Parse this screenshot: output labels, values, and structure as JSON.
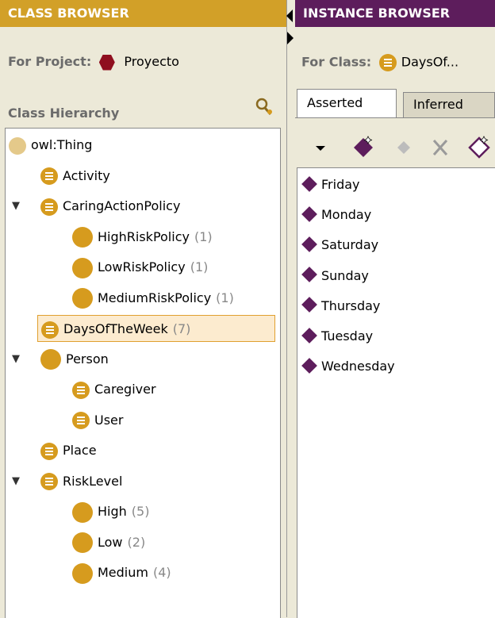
{
  "class_browser": {
    "header": "CLASS BROWSER",
    "for_label": "For Project:",
    "project_name": "Proyecto",
    "hierarchy_title": "Class Hierarchy",
    "tree": [
      {
        "label": "owl:Thing",
        "count": "",
        "depth": 0,
        "icon": "thing-icon",
        "expander": ""
      },
      {
        "label": "Activity",
        "count": "",
        "depth": 1,
        "icon": "named-class-icon",
        "expander": ""
      },
      {
        "label": "CaringActionPolicy",
        "count": "",
        "depth": 1,
        "icon": "named-class-icon",
        "expander": "▼"
      },
      {
        "label": "HighRiskPolicy",
        "count": "(1)",
        "depth": 2,
        "icon": "class-icon",
        "expander": ""
      },
      {
        "label": "LowRiskPolicy",
        "count": "(1)",
        "depth": 2,
        "icon": "class-icon",
        "expander": ""
      },
      {
        "label": "MediumRiskPolicy",
        "count": "(1)",
        "depth": 2,
        "icon": "class-icon",
        "expander": ""
      },
      {
        "label": "DaysOfTheWeek",
        "count": "(7)",
        "depth": 1,
        "icon": "named-class-icon",
        "expander": "",
        "selected": true
      },
      {
        "label": "Person",
        "count": "",
        "depth": 1,
        "icon": "class-icon",
        "expander": "▼"
      },
      {
        "label": "Caregiver",
        "count": "",
        "depth": 2,
        "icon": "named-class-icon",
        "expander": ""
      },
      {
        "label": "User",
        "count": "",
        "depth": 2,
        "icon": "named-class-icon",
        "expander": ""
      },
      {
        "label": "Place",
        "count": "",
        "depth": 1,
        "icon": "named-class-icon",
        "expander": ""
      },
      {
        "label": "RiskLevel",
        "count": "",
        "depth": 1,
        "icon": "named-class-icon",
        "expander": "▼"
      },
      {
        "label": "High",
        "count": "(5)",
        "depth": 2,
        "icon": "class-icon",
        "expander": ""
      },
      {
        "label": "Low",
        "count": "(2)",
        "depth": 2,
        "icon": "class-icon",
        "expander": ""
      },
      {
        "label": "Medium",
        "count": "(4)",
        "depth": 2,
        "icon": "class-icon",
        "expander": ""
      }
    ]
  },
  "instance_browser": {
    "header": "INSTANCE BROWSER",
    "for_label": "For Class:",
    "class_name": "DaysOf...",
    "tabs": [
      {
        "label": "Asserted",
        "active": true
      },
      {
        "label": "Inferred",
        "active": false
      }
    ],
    "instances": [
      "Friday",
      "Monday",
      "Saturday",
      "Sunday",
      "Thursday",
      "Tuesday",
      "Wednesday"
    ]
  },
  "colors": {
    "class_header": "#d2a028",
    "instance_header": "#5d1d5c",
    "class_icon": "#d69b1e",
    "instance_icon": "#5d1d5c",
    "project_icon": "#8f0f1f"
  }
}
